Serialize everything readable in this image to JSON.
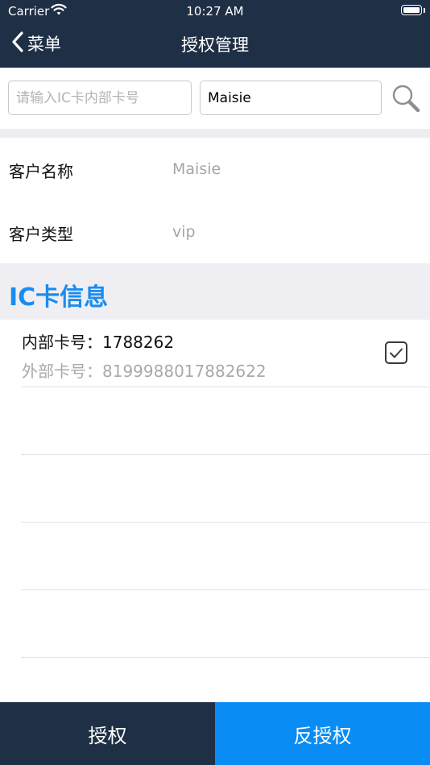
{
  "status_bar": {
    "carrier": "Carrier",
    "time": "10:27 AM"
  },
  "nav": {
    "back_label": "菜单",
    "title": "授权管理"
  },
  "search": {
    "card_placeholder": "请输入IC卡内部卡号",
    "name_value": "Maisie"
  },
  "customer": {
    "name_label": "客户名称",
    "name_value": "Maisie",
    "type_label": "客户类型",
    "type_value": "vip"
  },
  "section": {
    "title": "IC卡信息"
  },
  "cards": [
    {
      "internal": "内部卡号：1788262",
      "external": "外部卡号：8199988017882622",
      "checked": true
    }
  ],
  "actions": {
    "authorize": "授权",
    "deauthorize": "反授权"
  },
  "colors": {
    "nav": "#1f2f46",
    "accent": "#0a8cf5",
    "section_title": "#1a8cf0"
  }
}
